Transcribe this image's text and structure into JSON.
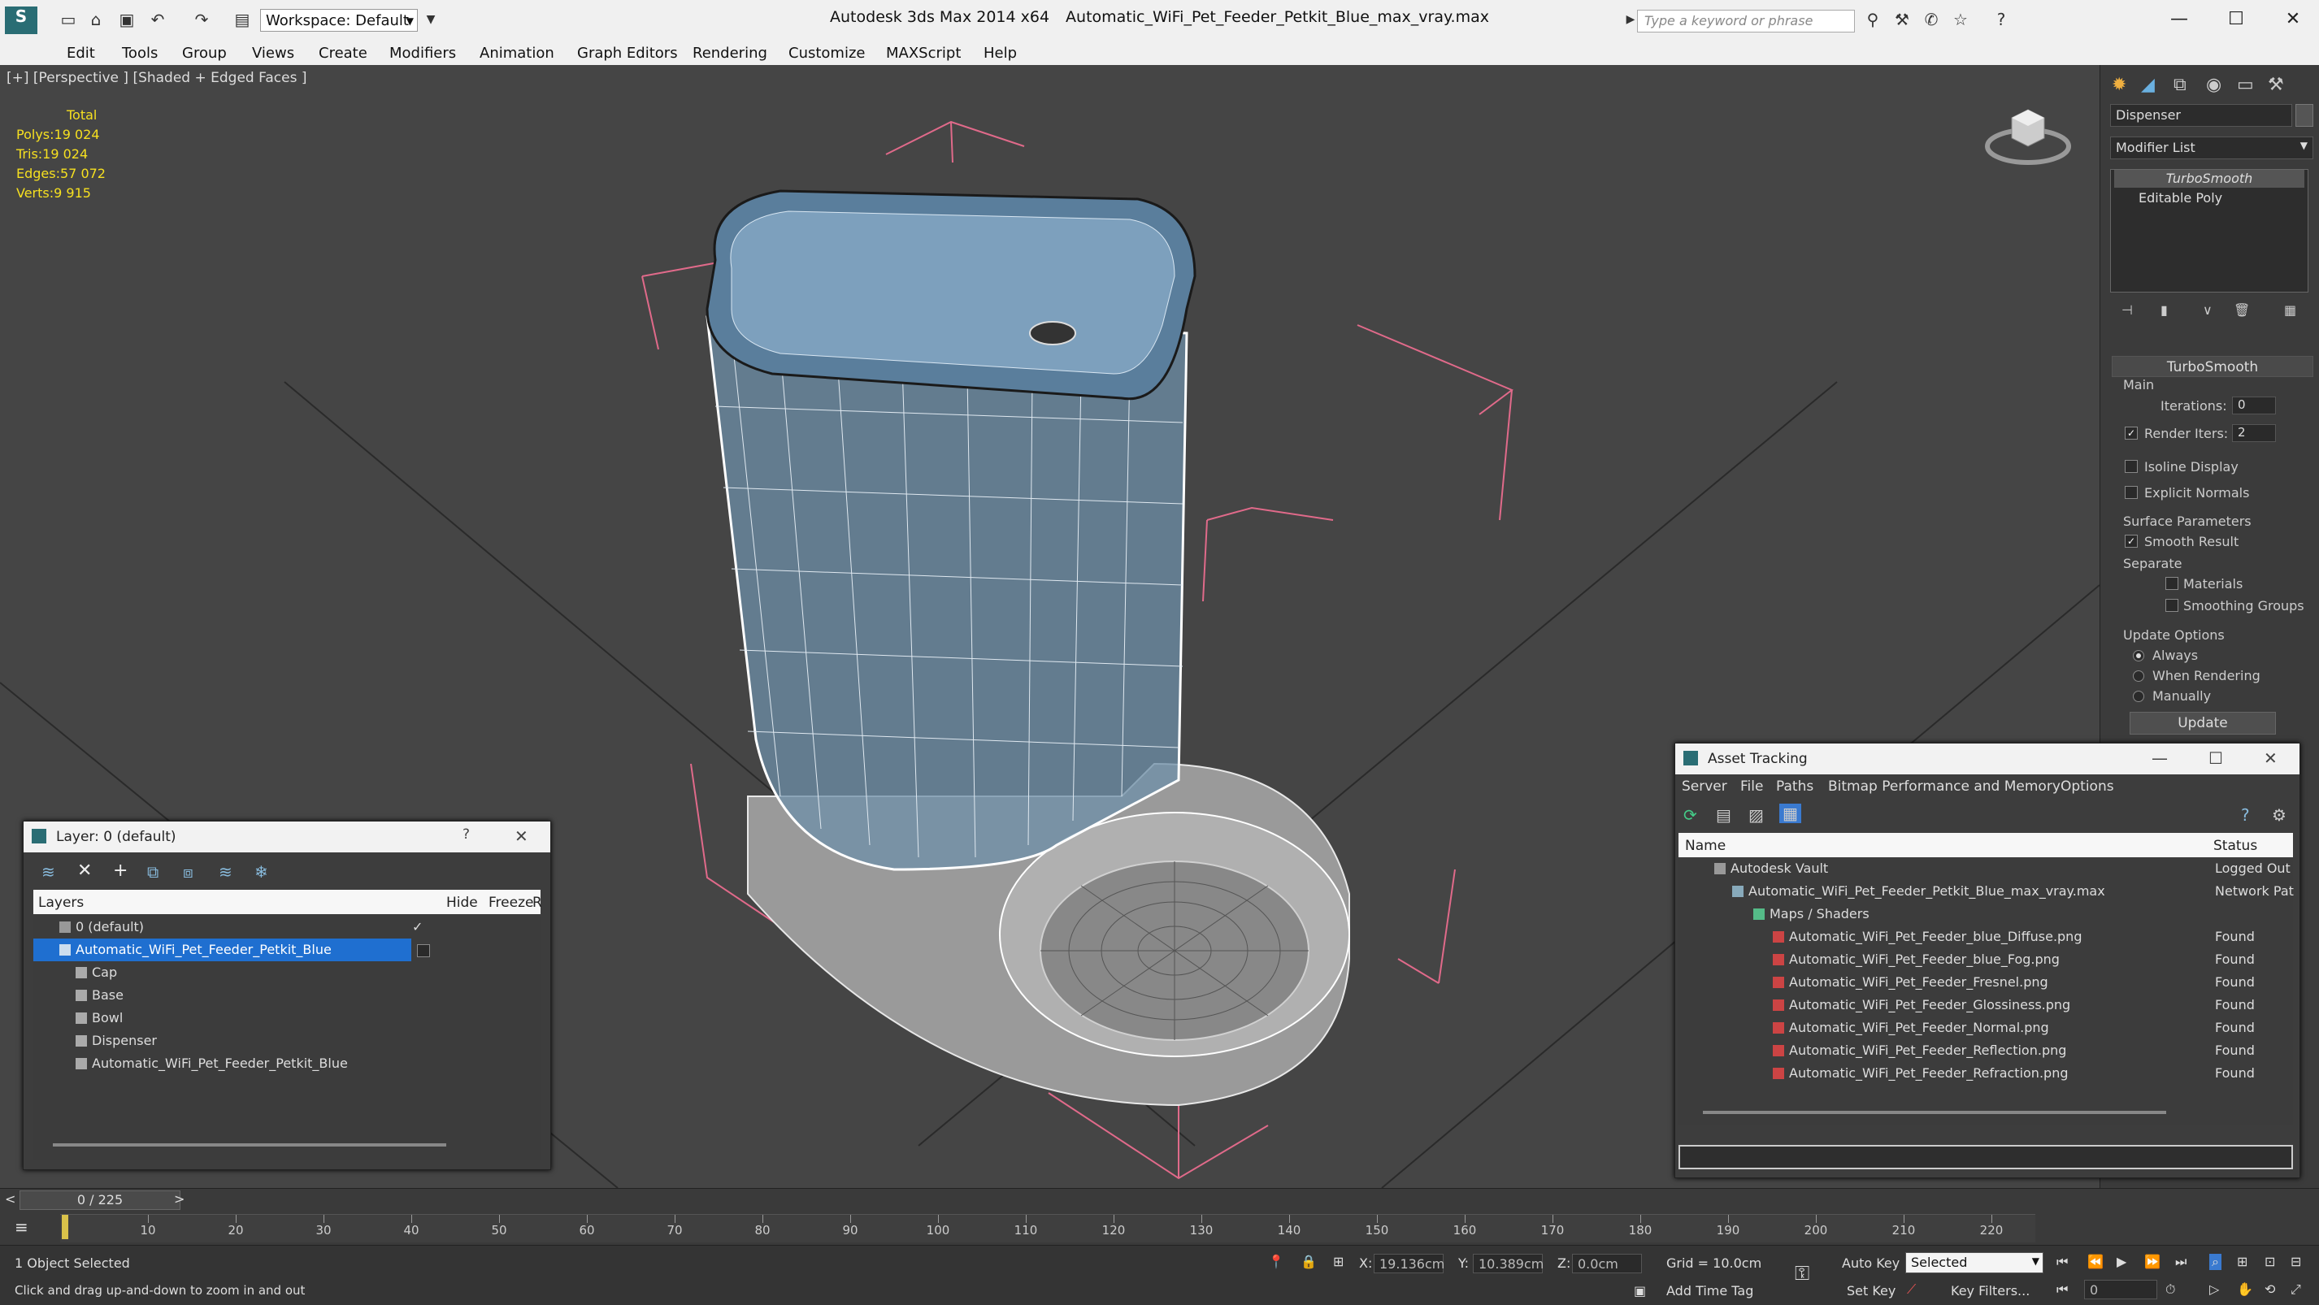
{
  "app": {
    "title": "Autodesk 3ds Max  2014 x64",
    "file": "Automatic_WiFi_Pet_Feeder_Petkit_Blue_max_vray.max",
    "workspace": "Workspace: Default",
    "search_placeholder": "Type a keyword or phrase"
  },
  "menu": [
    "Edit",
    "Tools",
    "Group",
    "Views",
    "Create",
    "Modifiers",
    "Animation",
    "Graph Editors",
    "Rendering",
    "Customize",
    "MAXScript",
    "Help"
  ],
  "viewport": {
    "label": "[+] [Perspective ] [Shaded + Edged Faces ]",
    "stats": {
      "header": "Total",
      "rows": [
        {
          "label": "Polys:",
          "value": "19 024"
        },
        {
          "label": "Tris:",
          "value": "19 024"
        },
        {
          "label": "Edges:",
          "value": "57 072"
        },
        {
          "label": "Verts:",
          "value": "9 915"
        }
      ]
    }
  },
  "command_panel": {
    "object_name": "Dispenser",
    "modifier_list": "Modifier List",
    "stack": [
      "TurboSmooth",
      "Editable Poly"
    ],
    "rollout_title": "TurboSmooth",
    "main_label": "Main",
    "iterations_label": "Iterations:",
    "iterations_value": "0",
    "render_iters_label": "Render Iters:",
    "render_iters_value": "2",
    "isoline_label": "Isoline Display",
    "explicit_normals_label": "Explicit Normals",
    "surface_params_label": "Surface Parameters",
    "smooth_result_label": "Smooth Result",
    "separate_label": "Separate",
    "materials_label": "Materials",
    "smoothing_groups_label": "Smoothing Groups",
    "update_options_label": "Update Options",
    "always_label": "Always",
    "when_rendering_label": "When Rendering",
    "manually_label": "Manually",
    "update_button": "Update"
  },
  "layer_window": {
    "title": "Layer: 0 (default)",
    "help": "?",
    "columns": [
      "Layers",
      "Hide",
      "Freeze",
      "R"
    ],
    "rows": [
      {
        "label": "0 (default)",
        "indent": 0
      },
      {
        "label": "Automatic_WiFi_Pet_Feeder_Petkit_Blue",
        "indent": 0
      },
      {
        "label": "Cap",
        "indent": 1
      },
      {
        "label": "Base",
        "indent": 1
      },
      {
        "label": "Bowl",
        "indent": 1
      },
      {
        "label": "Dispenser",
        "indent": 1
      },
      {
        "label": "Automatic_WiFi_Pet_Feeder_Petkit_Blue",
        "indent": 1
      }
    ]
  },
  "asset_window": {
    "title": "Asset Tracking",
    "menu": [
      "Server",
      "File",
      "Paths",
      "Bitmap Performance and Memory",
      "Options"
    ],
    "columns": [
      "Name",
      "Status"
    ],
    "rows": [
      {
        "name": "Autodesk Vault",
        "status": "Logged Out"
      },
      {
        "name": "Automatic_WiFi_Pet_Feeder_Petkit_Blue_max_vray.max",
        "status": "Network Pat"
      },
      {
        "name": "Maps / Shaders",
        "status": ""
      },
      {
        "name": "Automatic_WiFi_Pet_Feeder_blue_Diffuse.png",
        "status": "Found"
      },
      {
        "name": "Automatic_WiFi_Pet_Feeder_blue_Fog.png",
        "status": "Found"
      },
      {
        "name": "Automatic_WiFi_Pet_Feeder_Fresnel.png",
        "status": "Found"
      },
      {
        "name": "Automatic_WiFi_Pet_Feeder_Glossiness.png",
        "status": "Found"
      },
      {
        "name": "Automatic_WiFi_Pet_Feeder_Normal.png",
        "status": "Found"
      },
      {
        "name": "Automatic_WiFi_Pet_Feeder_Reflection.png",
        "status": "Found"
      },
      {
        "name": "Automatic_WiFi_Pet_Feeder_Refraction.png",
        "status": "Found"
      }
    ]
  },
  "timeline": {
    "frame": "0 / 225",
    "ticks": [
      "10",
      "20",
      "30",
      "40",
      "50",
      "60",
      "70",
      "80",
      "90",
      "100",
      "110",
      "120",
      "130",
      "140",
      "150",
      "160",
      "170",
      "180",
      "190",
      "200",
      "210",
      "220"
    ]
  },
  "status": {
    "selection": "1 Object Selected",
    "prompt": "Click and drag up-and-down to zoom in and out",
    "x_label": "X:",
    "x_value": "19.136cm",
    "y_label": "Y:",
    "y_value": "10.389cm",
    "z_label": "Z:",
    "z_value": "0.0cm",
    "grid": "Grid = 10.0cm",
    "add_time_tag": "Add Time Tag",
    "auto_key": "Auto Key",
    "set_key": "Set Key",
    "selected": "Selected",
    "key_filters": "Key Filters...",
    "frame_field": "0"
  }
}
